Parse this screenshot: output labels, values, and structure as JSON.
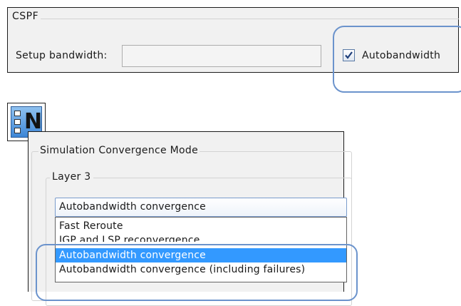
{
  "cspf": {
    "title": "CSPF",
    "setup_bandwidth_label": "Setup bandwidth:",
    "setup_bandwidth_value": "",
    "autobandwidth_label": "Autobandwidth",
    "autobandwidth_checked": true
  },
  "app_icon": {
    "letter": "N",
    "icon_name": "checklist-app-icon"
  },
  "simulation": {
    "title": "Simulation Convergence Mode",
    "layer3_label": "Layer 3",
    "selected_value": "Autobandwidth convergence",
    "options": [
      "Fast Reroute",
      "IGP and LSP reconvergence",
      "Autobandwidth convergence",
      "Autobandwidth convergence (including failures)"
    ],
    "highlighted_option_index": 2
  },
  "colors": {
    "highlight_ring": "#6b93cc",
    "selection_bg": "#3399ff",
    "panel_bg": "#f1f1f1"
  }
}
